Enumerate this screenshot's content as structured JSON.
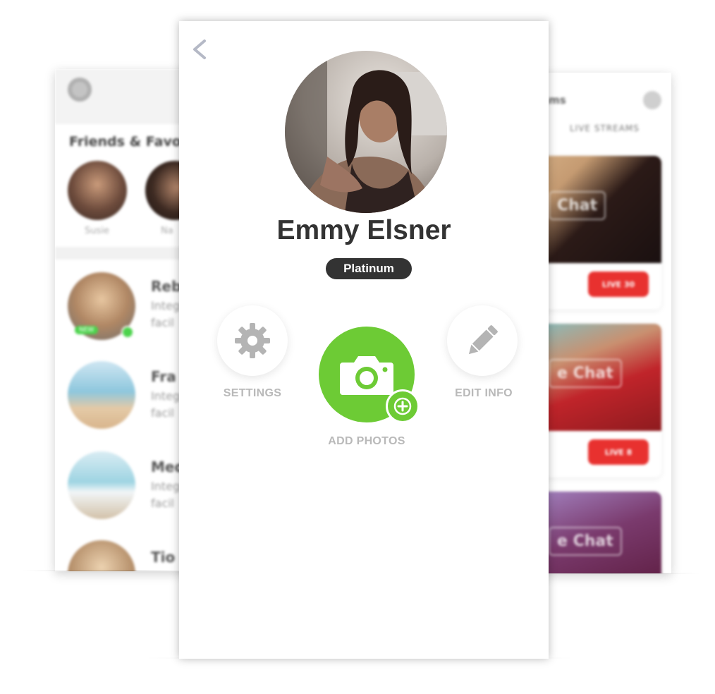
{
  "left_screen": {
    "section_title": "Friends & Favo",
    "favorites": [
      {
        "name": "Susie"
      },
      {
        "name": "Na"
      }
    ],
    "list": [
      {
        "name": "Reb",
        "line1": "Integ",
        "line2": "facil",
        "badge": "NEW"
      },
      {
        "name": "Fra",
        "line1": "Integ",
        "line2": "facil"
      },
      {
        "name": "Med",
        "line1": "Integ",
        "line2": "facil"
      },
      {
        "name": "Tio"
      }
    ]
  },
  "right_screen": {
    "title": "ams",
    "tab": "LIVE STREAMS",
    "cards": [
      {
        "chat_label": "Chat",
        "live_label": "LIVE 30"
      },
      {
        "chat_label": "e Chat",
        "live_label": "LIVE 8"
      },
      {
        "chat_label": "e Chat"
      }
    ]
  },
  "profile": {
    "name": "Emmy Elsner",
    "tier": "Platinum"
  },
  "actions": {
    "settings_label": "SETTINGS",
    "add_photos_label": "ADD PHOTOS",
    "edit_info_label": "EDIT INFO"
  },
  "icons": {
    "back": "chevron-left-icon",
    "settings": "gear-icon",
    "add_photos": "camera-icon",
    "plus": "plus-icon",
    "edit": "pencil-icon"
  },
  "colors": {
    "accent_green": "#6dcb35",
    "badge_dark": "#333333",
    "label_gray": "#b9b9b9",
    "live_red": "#e8312f"
  }
}
